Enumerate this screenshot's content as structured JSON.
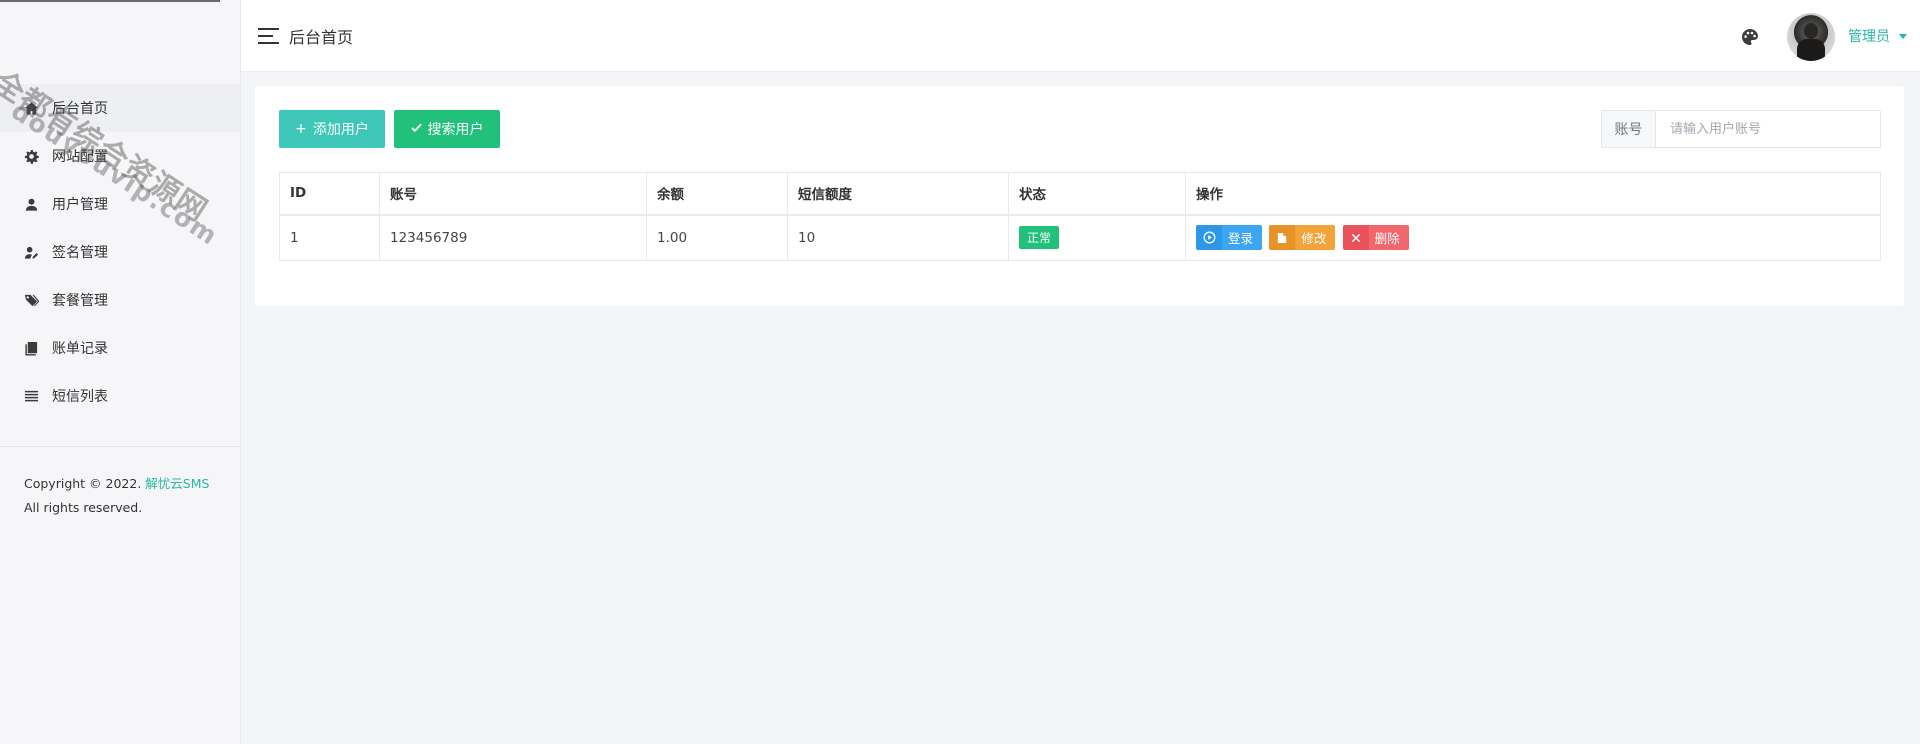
{
  "sidebar": {
    "items": [
      {
        "label": "后台首页",
        "icon": "home-icon",
        "active": true
      },
      {
        "label": "网站配置",
        "icon": "gear-icon",
        "active": false
      },
      {
        "label": "用户管理",
        "icon": "user-icon",
        "active": false
      },
      {
        "label": "签名管理",
        "icon": "user-edit-icon",
        "active": false
      },
      {
        "label": "套餐管理",
        "icon": "tags-icon",
        "active": false
      },
      {
        "label": "账单记录",
        "icon": "book-icon",
        "active": false
      },
      {
        "label": "短信列表",
        "icon": "list-icon",
        "active": false
      }
    ],
    "copyright_prefix": "Copyright © 2022.",
    "copyright_brand": "解忧云SMS",
    "copyright_suffix": "All rights reserved."
  },
  "watermark": {
    "line1": "全都有综合资源网",
    "line2": "douyouvip.com"
  },
  "header": {
    "title": "后台首页",
    "user_name": "管理员"
  },
  "toolbar": {
    "add_label": "添加用户",
    "search_label": "搜索用户"
  },
  "search": {
    "addon": "账号",
    "placeholder": "请输入用户账号",
    "value": ""
  },
  "table": {
    "headers": [
      "ID",
      "账号",
      "余额",
      "短信额度",
      "状态",
      "操作"
    ],
    "rows": [
      {
        "id": "1",
        "account": "123456789",
        "balance": "1.00",
        "quota": "10",
        "status": "正常"
      }
    ],
    "actions": {
      "login": "登录",
      "edit": "修改",
      "delete": "删除"
    }
  },
  "colors": {
    "accent": "#26b7a6",
    "add_button": "#3ec7b8",
    "search_button": "#21c17c",
    "status_ok": "#21c17c",
    "login": "#3ba6f2",
    "edit": "#f3a33a",
    "delete": "#f2666d"
  }
}
